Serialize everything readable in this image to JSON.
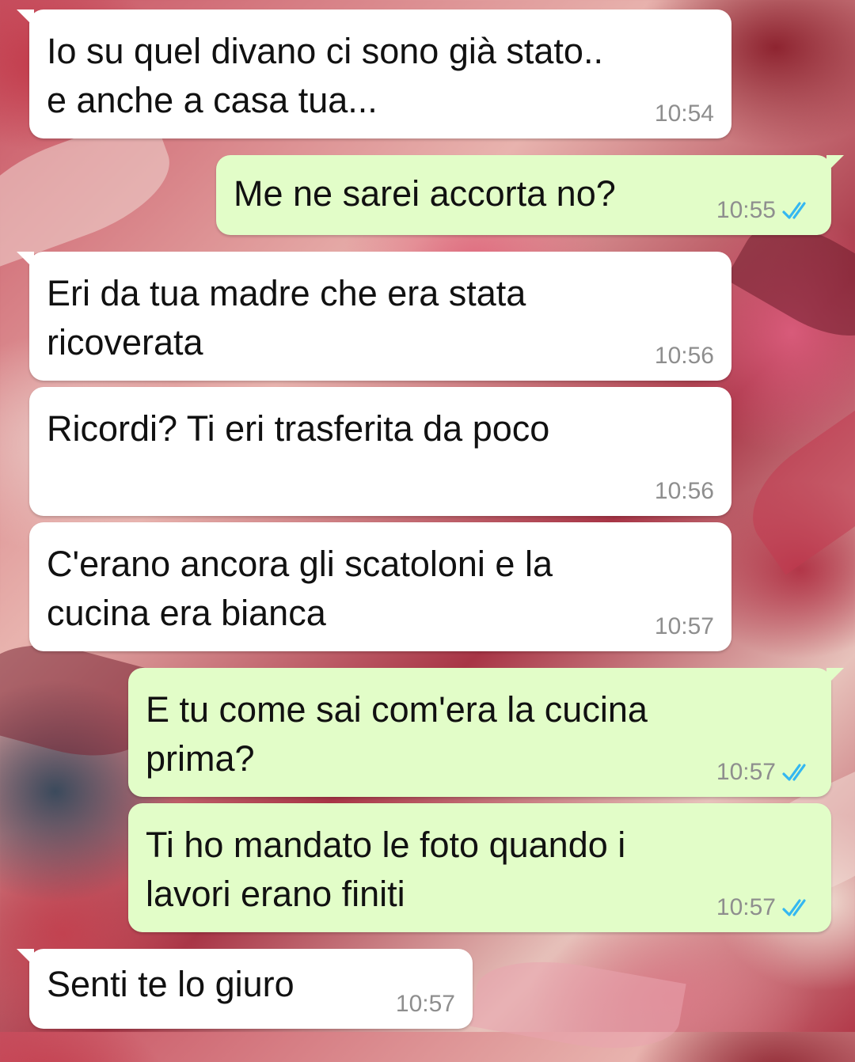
{
  "colors": {
    "incoming_bubble": "#ffffff",
    "outgoing_bubble": "#e2fdc8",
    "read_ticks": "#34b7f1",
    "timestamp": "#8e8e8e"
  },
  "ticks_icon": "double-check-read-icon",
  "messages": [
    {
      "direction": "incoming",
      "text": "Io su quel divano ci sono già stato..\ne anche a casa tua...",
      "time": "10:54"
    },
    {
      "direction": "outgoing",
      "text": "Me ne sarei accorta no?",
      "time": "10:55",
      "status": "read"
    },
    {
      "direction": "incoming",
      "text": "Eri da tua madre che era stata\nricoverata",
      "time": "10:56"
    },
    {
      "direction": "incoming",
      "text": "Ricordi? Ti eri trasferita da poco",
      "time": "10:56"
    },
    {
      "direction": "incoming",
      "text": "C'erano ancora gli scatoloni e la\ncucina era bianca",
      "time": "10:57"
    },
    {
      "direction": "outgoing",
      "text": "E tu come sai com'era la cucina\nprima?",
      "time": "10:57",
      "status": "read"
    },
    {
      "direction": "outgoing",
      "text": "Ti ho mandato le foto quando i\nlavori erano finiti",
      "time": "10:57",
      "status": "read"
    },
    {
      "direction": "incoming",
      "text": "Senti te lo giuro",
      "time": "10:57"
    }
  ]
}
